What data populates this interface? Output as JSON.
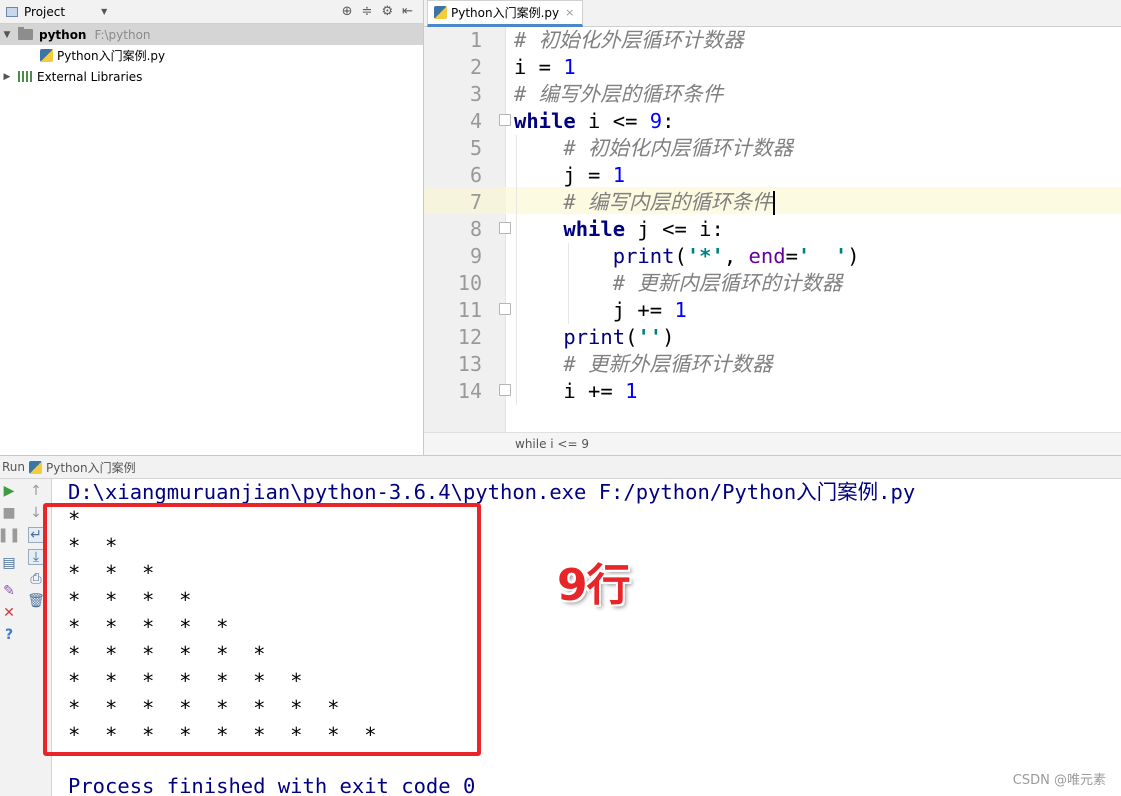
{
  "project_panel": {
    "title": "Project",
    "tree": {
      "root_name": "python",
      "root_path": "F:\\python",
      "file_name": "Python入门案例.py",
      "libraries": "External Libraries"
    }
  },
  "editor": {
    "tab_label": "Python入门案例.py",
    "line_numbers": [
      "1",
      "2",
      "3",
      "4",
      "5",
      "6",
      "7",
      "8",
      "9",
      "10",
      "11",
      "12",
      "13",
      "14"
    ],
    "breadcrumb": "while i <= 9"
  },
  "run_panel": {
    "label": "Run",
    "config_name": "Python入门案例",
    "command": "D:\\xiangmuruanjian\\python-3.6.4\\python.exe F:/python/Python入门案例.py",
    "output_lines": [
      "*",
      "*  *",
      "*  *  *",
      "*  *  *  *",
      "*  *  *  *  *",
      "*  *  *  *  *  *",
      "*  *  *  *  *  *  *",
      "*  *  *  *  *  *  *  *",
      "*  *  *  *  *  *  *  *  *"
    ],
    "exit_message": "Process finished with exit code 0"
  },
  "annotation": {
    "text": "9行",
    "color": "#e8262a"
  },
  "watermark": "CSDN @唯元素",
  "icons": {
    "run": "play-icon",
    "stop": "stop-icon",
    "pause": "pause-icon",
    "settings": "gear-icon"
  }
}
